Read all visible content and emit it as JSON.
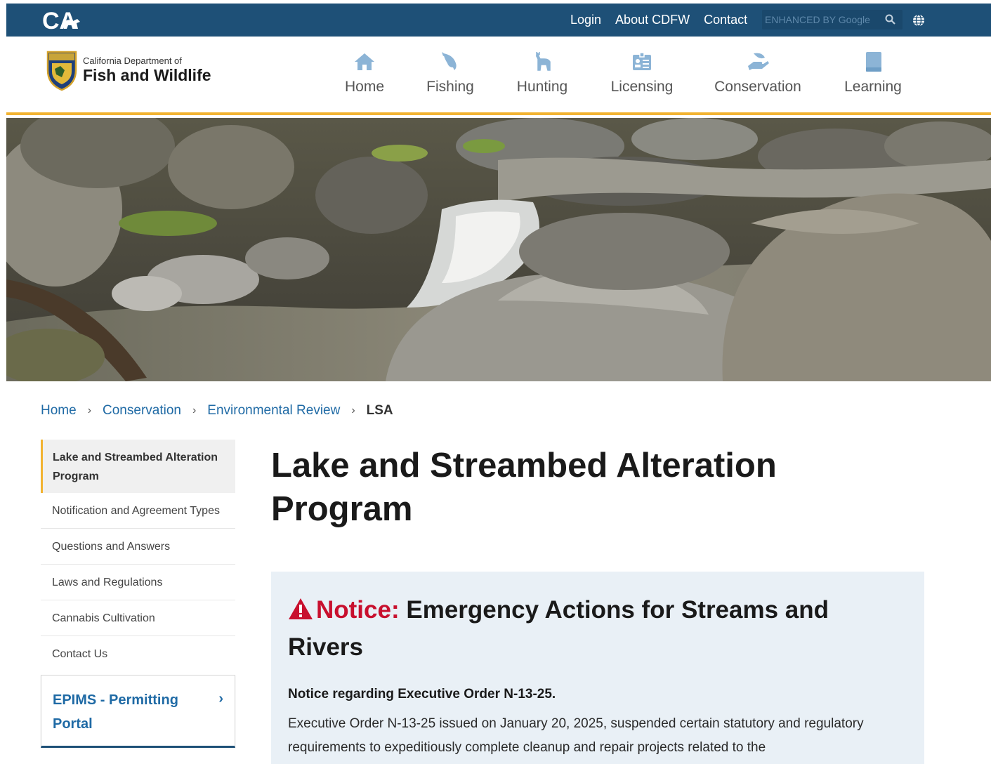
{
  "utility": {
    "links": [
      "Login",
      "About CDFW",
      "Contact"
    ],
    "search_placeholder": "ENHANCED BY Google"
  },
  "brand": {
    "small": "California Department of",
    "big": "Fish and Wildlife"
  },
  "nav": [
    {
      "label": "Home",
      "icon": "house-icon"
    },
    {
      "label": "Fishing",
      "icon": "fish-icon"
    },
    {
      "label": "Hunting",
      "icon": "deer-icon"
    },
    {
      "label": "Licensing",
      "icon": "id-card-icon"
    },
    {
      "label": "Conservation",
      "icon": "hand-leaf-icon"
    },
    {
      "label": "Learning",
      "icon": "book-icon"
    }
  ],
  "breadcrumb": {
    "items": [
      "Home",
      "Conservation",
      "Environmental Review"
    ],
    "current": "LSA"
  },
  "sidebar": {
    "active": "Lake and Streambed Alteration Program",
    "items": [
      "Notification and Agreement Types",
      "Questions and Answers",
      "Laws and Regulations",
      "Cannabis Cultivation",
      "Contact Us"
    ],
    "portal": "EPIMS - Permitting Portal"
  },
  "main": {
    "title": "Lake and Streambed Alteration Program",
    "notice": {
      "prefix": "Notice:",
      "heading": "Emergency Actions for Streams and Rivers",
      "sub": "Notice regarding Executive Order N-13-25.",
      "body": "Executive Order N-13-25 issued on January 20, 2025, suspended certain statutory and regulatory requirements to expeditiously complete cleanup and repair projects related to the"
    }
  },
  "colors": {
    "utility_bar": "#1e5077",
    "accent": "#f2b331",
    "link": "#1f6aa5",
    "notice_bg": "#e9f0f6",
    "warning": "#c8102e"
  }
}
